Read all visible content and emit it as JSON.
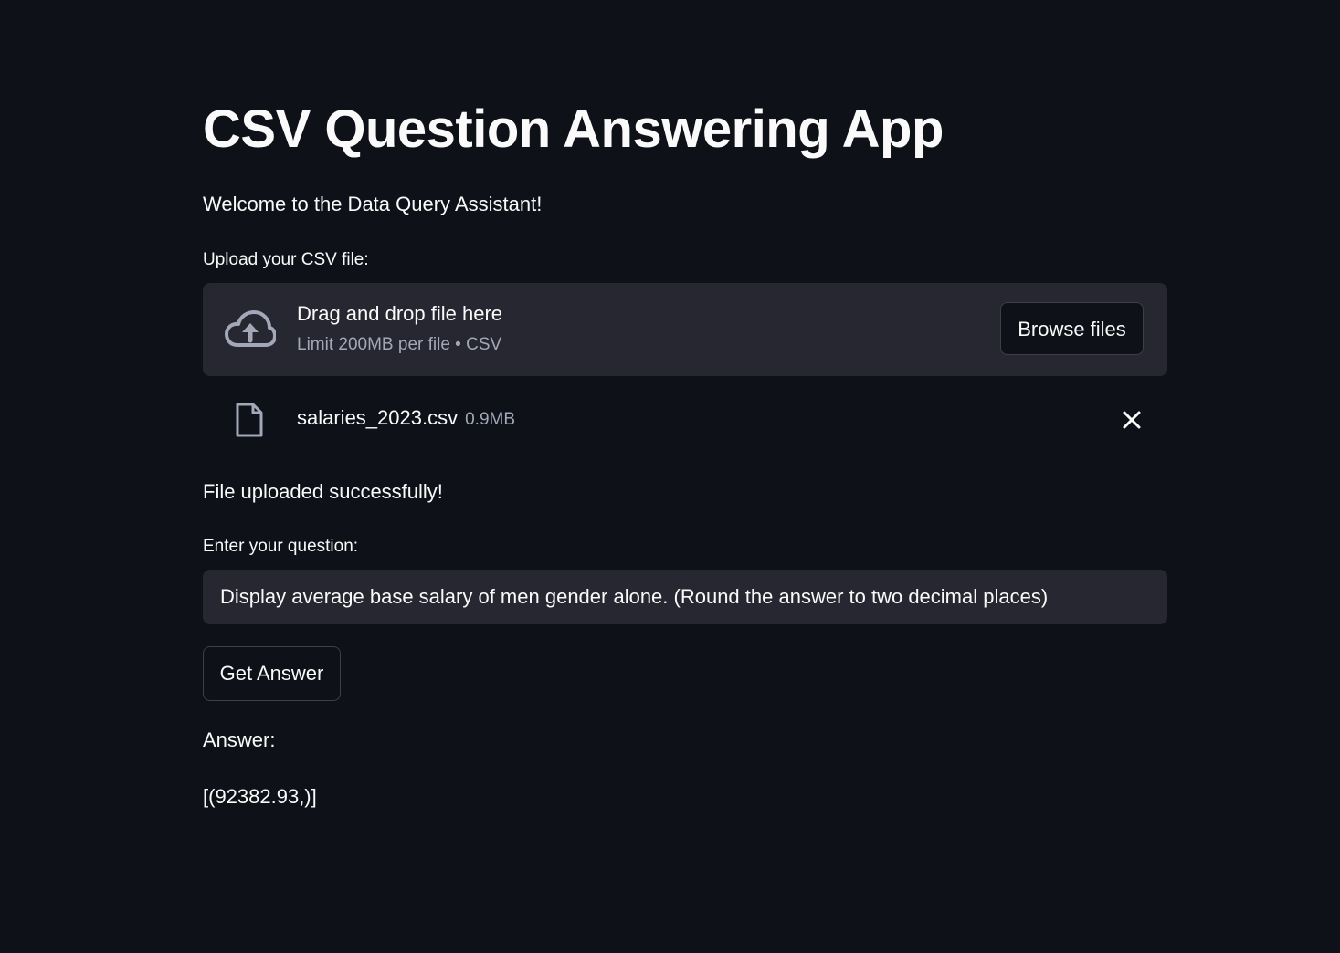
{
  "app": {
    "title": "CSV Question Answering App",
    "welcome": "Welcome to the Data Query Assistant!"
  },
  "uploader": {
    "label": "Upload your CSV file:",
    "drop_title": "Drag and drop file here",
    "drop_subtitle": "Limit 200MB per file • CSV",
    "browse_label": "Browse files",
    "icon": "cloud-upload-icon"
  },
  "uploaded_file": {
    "name": "salaries_2023.csv",
    "size": "0.9MB",
    "icon": "file-icon",
    "remove_icon": "close-icon"
  },
  "status": {
    "message": "File uploaded successfully!"
  },
  "question": {
    "label": "Enter your question:",
    "value": "Display average base salary of men gender alone. (Round the answer to two decimal places)"
  },
  "actions": {
    "get_answer_label": "Get Answer"
  },
  "answer": {
    "label": "Answer:",
    "value": "[(92382.93,)]"
  },
  "colors": {
    "background": "#0e1117",
    "panel": "#262730",
    "text": "#fafafa",
    "muted_text": "#a3a8b8",
    "border": "#3d4049"
  }
}
